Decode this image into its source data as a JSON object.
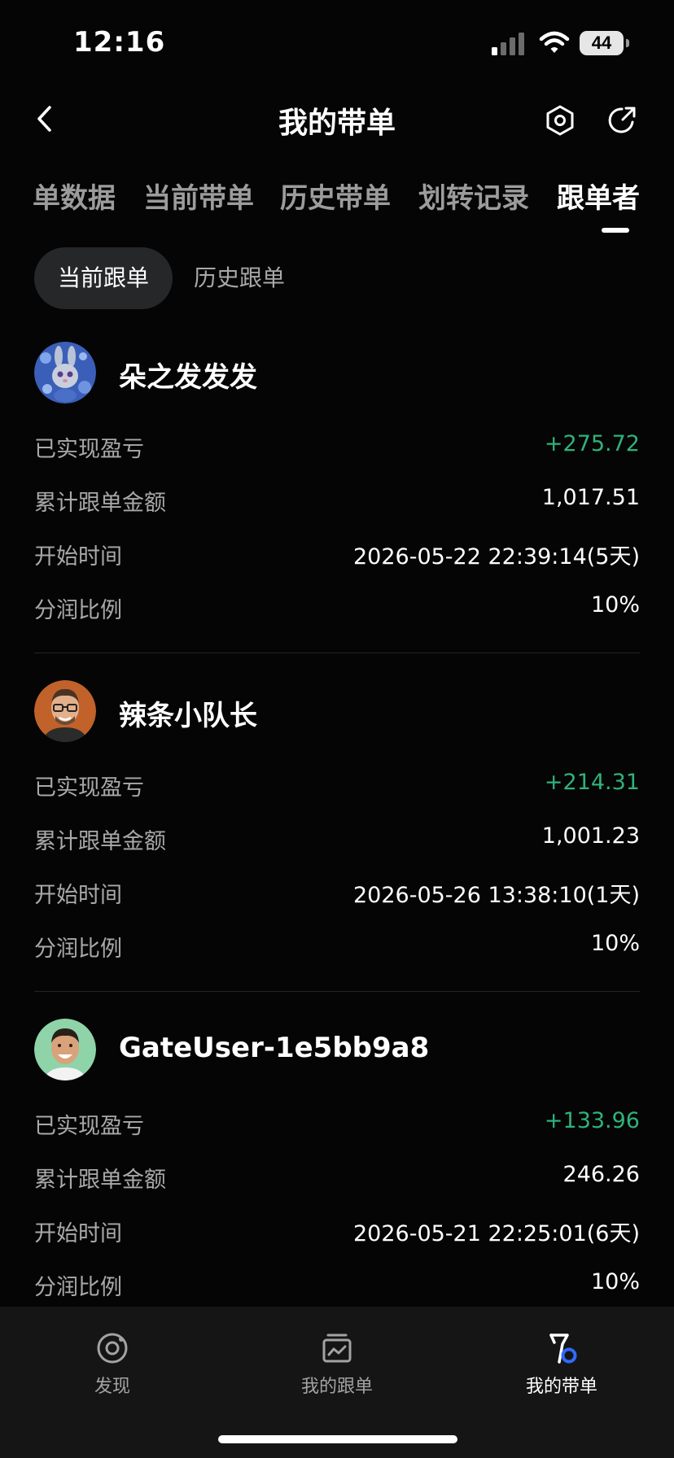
{
  "status_bar": {
    "time": "12:16",
    "battery": "44"
  },
  "header": {
    "title": "我的带单",
    "back_icon": "chevron-left-icon",
    "settings_icon": "hexagon-gear-icon",
    "share_icon": "share-arrow-icon"
  },
  "tabs": [
    {
      "label": "单数据",
      "active": false
    },
    {
      "label": "当前带单",
      "active": false
    },
    {
      "label": "历史带单",
      "active": false
    },
    {
      "label": "划转记录",
      "active": false
    },
    {
      "label": "跟单者",
      "active": true
    }
  ],
  "subtabs": [
    {
      "label": "当前跟单",
      "active": true
    },
    {
      "label": "历史跟单",
      "active": false
    }
  ],
  "colors": {
    "background": "#050505",
    "profit": "#2fb27a",
    "label": "#a9a9a9",
    "active_tab": "#ffffff",
    "inactive_tab": "#9c9c9c",
    "accent_blue": "#2f6bff"
  },
  "stat_labels": {
    "realized_pnl": "已实现盈亏",
    "total_amount": "累计跟单金额",
    "start_time": "开始时间",
    "profit_share": "分润比例"
  },
  "followers": [
    {
      "name": "朵之发发发",
      "avatar": "bunny-avatar",
      "realized_pnl": "+275.72",
      "total_amount": "1,017.51",
      "start_time": "2026-05-22 22:39:14(5天)",
      "profit_share": "10%"
    },
    {
      "name": "辣条小队长",
      "avatar": "man-with-glasses-avatar",
      "realized_pnl": "+214.31",
      "total_amount": "1,001.23",
      "start_time": "2026-05-26 13:38:10(1天)",
      "profit_share": "10%"
    },
    {
      "name": "GateUser-1e5bb9a8",
      "avatar": "smiling-man-avatar",
      "realized_pnl": "+133.96",
      "total_amount": "246.26",
      "start_time": "2026-05-21 22:25:01(6天)",
      "profit_share": "10%"
    }
  ],
  "bottom_nav": [
    {
      "label": "发现",
      "icon": "discover-icon",
      "active": false
    },
    {
      "label": "我的跟单",
      "icon": "copy-trade-icon",
      "active": false
    },
    {
      "label": "我的带单",
      "icon": "lead-trade-icon",
      "active": true
    }
  ]
}
